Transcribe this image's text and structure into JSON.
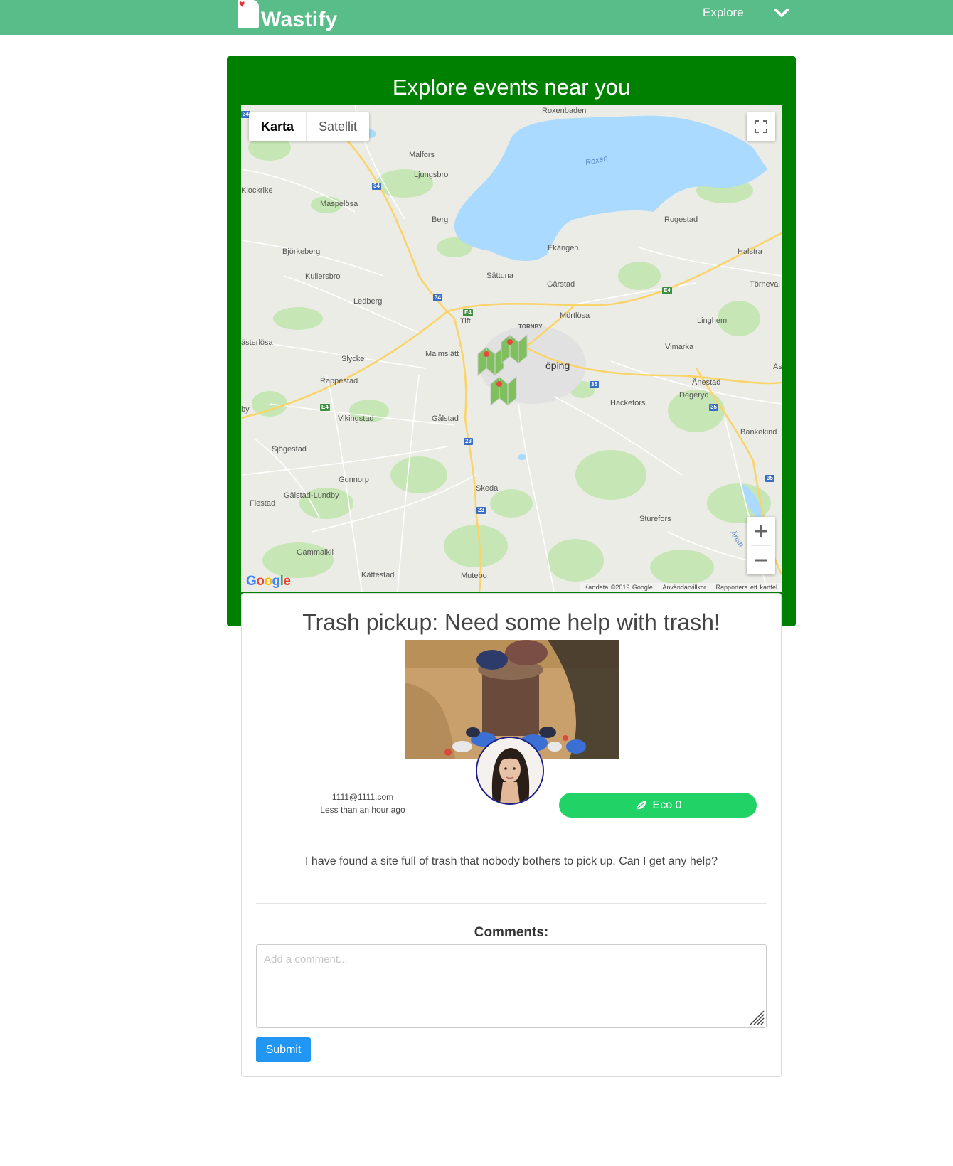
{
  "navbar": {
    "brand": "Wastify",
    "explore_label": "Explore",
    "menu_icon": "chevron-down-icon"
  },
  "explore": {
    "title": "Explore events near you"
  },
  "map": {
    "type_controls": [
      "Karta",
      "Satellit"
    ],
    "active_type": "Karta",
    "attribution": {
      "data": "Kartdata ©2019 Google",
      "terms": "Användarvillkor",
      "report": "Rapportera ett kartfel"
    },
    "google_logo": "Google",
    "places": {
      "roxenbaden": "Roxenbaden",
      "roxen": "Roxen",
      "malfors": "Malfors",
      "ljungsbro": "Ljungsbro",
      "klockrike": "Klockrike",
      "maspelosa": "Maspelösa",
      "berg": "Berg",
      "rogestad": "Rogestad",
      "bjorkeberg": "Björkeberg",
      "ekangen": "Ekängen",
      "halstra": "Halstra",
      "kullersbro": "Kullersbro",
      "sattuna": "Sättuna",
      "garstad": "Gärstad",
      "torneval": "Törneval",
      "ledberg": "Ledberg",
      "tift": "Tift",
      "mortlosa": "Mörtlösa",
      "tornby": "TORNBY",
      "linghem": "Linghem",
      "vasterlosa": "ästerlösa",
      "malmslatt": "Malmslätt",
      "linkoping": "öping",
      "vimarka": "Vimarka",
      "slycke": "Slycke",
      "as": "As",
      "rappestad": "Rappestad",
      "anestad": "Ånestad",
      "hackefors": "Hackefors",
      "degeryd": "Degeryd",
      "vikingstad": "Vikingstad",
      "galstad": "Gålstad",
      "bankekind": "Bankekind",
      "sjogestad": "Sjögestad",
      "gunnorp": "Gunnorp",
      "skeda": "Skeda",
      "galstad_lundby": "Gälstad-Lundby",
      "fiestad": "Fiestad",
      "sturefors": "Sturefors",
      "gammalkil": "Gammalkil",
      "kattestad": "Kättestad",
      "mutebo": "Mutebo",
      "arian": "Ärian",
      "by": "by"
    },
    "road_shields": {
      "r34a": "34",
      "r34b": "34",
      "r34c": "34",
      "e4a": "E4",
      "e4b": "E4",
      "e4c": "E4",
      "r35a": "35",
      "r35b": "35",
      "r35c": "35",
      "r23a": "23",
      "r23b": "23"
    }
  },
  "event": {
    "title": "Trash pickup: Need some help with trash!",
    "author_email": "1111@1111.com",
    "posted_time": "Less than an hour ago",
    "eco_label": "Eco 0",
    "description": "I have found a site full of trash that nobody bothers to pick up. Can I get any help?"
  },
  "comments": {
    "label": "Comments:",
    "placeholder": "Add a comment...",
    "submit_label": "Submit"
  },
  "colors": {
    "navbar": "#58bd88",
    "panel": "#008000",
    "eco": "#21d366",
    "submit": "#2196f3",
    "water": "#aadaff"
  }
}
